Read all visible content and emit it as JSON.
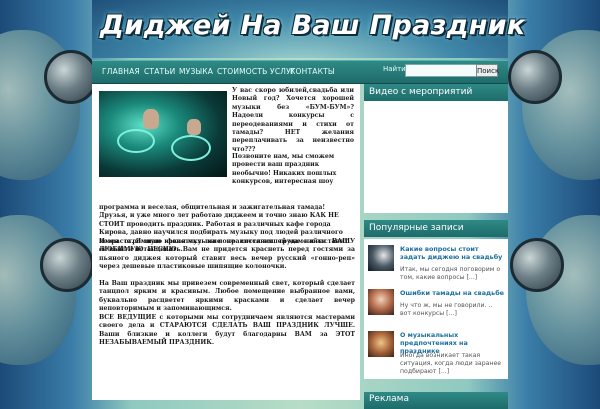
{
  "site": {
    "title": "Диджей На Ваш Праздник"
  },
  "nav": {
    "items": [
      "ГЛАВНАЯ",
      "СТАТЬИ",
      "МУЗЫКА",
      "СТОИМОСТЬ УСЛУГ",
      "КОНТАКТЫ"
    ]
  },
  "search": {
    "label": "Найти:",
    "value": "",
    "button": "Поиск"
  },
  "article": {
    "p1": "У вас скоро юбилей,свадьба или Новый год? Хочется хорошей музыки без «БУМ-БУМ»? Надоели конкурсы с переодеваниями и стихи от тамады? НЕТ желания переплачивать за неизвестно что???",
    "p2_intro": "Позвоните нам, мы сможем провести ваш праздник необычно! Никаких пошлых конкурсов, интересная шоу",
    "p2_rest": "программа и веселая, общительная и зажигательная тамада! Друзья, и уже много лет работаю диджеем и точно знаю КАК НЕ СТОИТ проводить праздник. Работая в различных кафе города Кирова, давно научился подбирать музыку под людей различного возраста. Я знаю какая музыка понравится вашей маме и заставит ее выйти потанцевать.",
    "p3": "Имея огромную фонотеку мне не составит труда найти ВАШУ ЛЮБИМУЮ ПЕСНЮ. Вам не придется краснеть перед гостями за пьяного диджея который ставит весь вечер русский «гонно-реп» через дешевые пластиковые шипящие колоночки.",
    "p4": "На Ваш праздник мы привезем современный свет, который сделает танцпол ярким и красивым. Любое помещение выбранное вами, буквально расцветет яркими красками и сделает вечер неповторимым и запоминающимся.",
    "p5": "ВСЕ ВЕДУЩИЕ с которыми мы сотрудничаем являются мастерами своего дела и СТАРАЮТСЯ СДЕЛАТЬ ВАШ ПРАЗДНИК ЛУЧШЕ. Ваши близкие и коллеги будут благодарны ВАМ за ЭТОТ НЕЗАБЫВАЕМЫЙ ПРАЗДНИК."
  },
  "sidebar": {
    "video_title": "Видео с мероприятий",
    "popular_title": "Популярные записи",
    "posts": [
      {
        "title": "Какие вопросы стоит задать диджею на свадьбу",
        "excerpt": "Итак, мы сегодня поговорим о том, какие вопросы [...]"
      },
      {
        "title": "Ошибки тамады на свадьбе",
        "excerpt": "Ну что ж, мы не говорили. .. вот конкурсы [...]"
      },
      {
        "title": "О музыкальных предпочтениях на празднике",
        "excerpt": "Иногда возникает такая ситуация, когда люди заранее подбирают [...]"
      }
    ],
    "ads_title": "Реклама"
  },
  "colors": {
    "nav": "#2f8a86",
    "link": "#1a6fa0",
    "accent_bg": "#b7ddc6"
  }
}
